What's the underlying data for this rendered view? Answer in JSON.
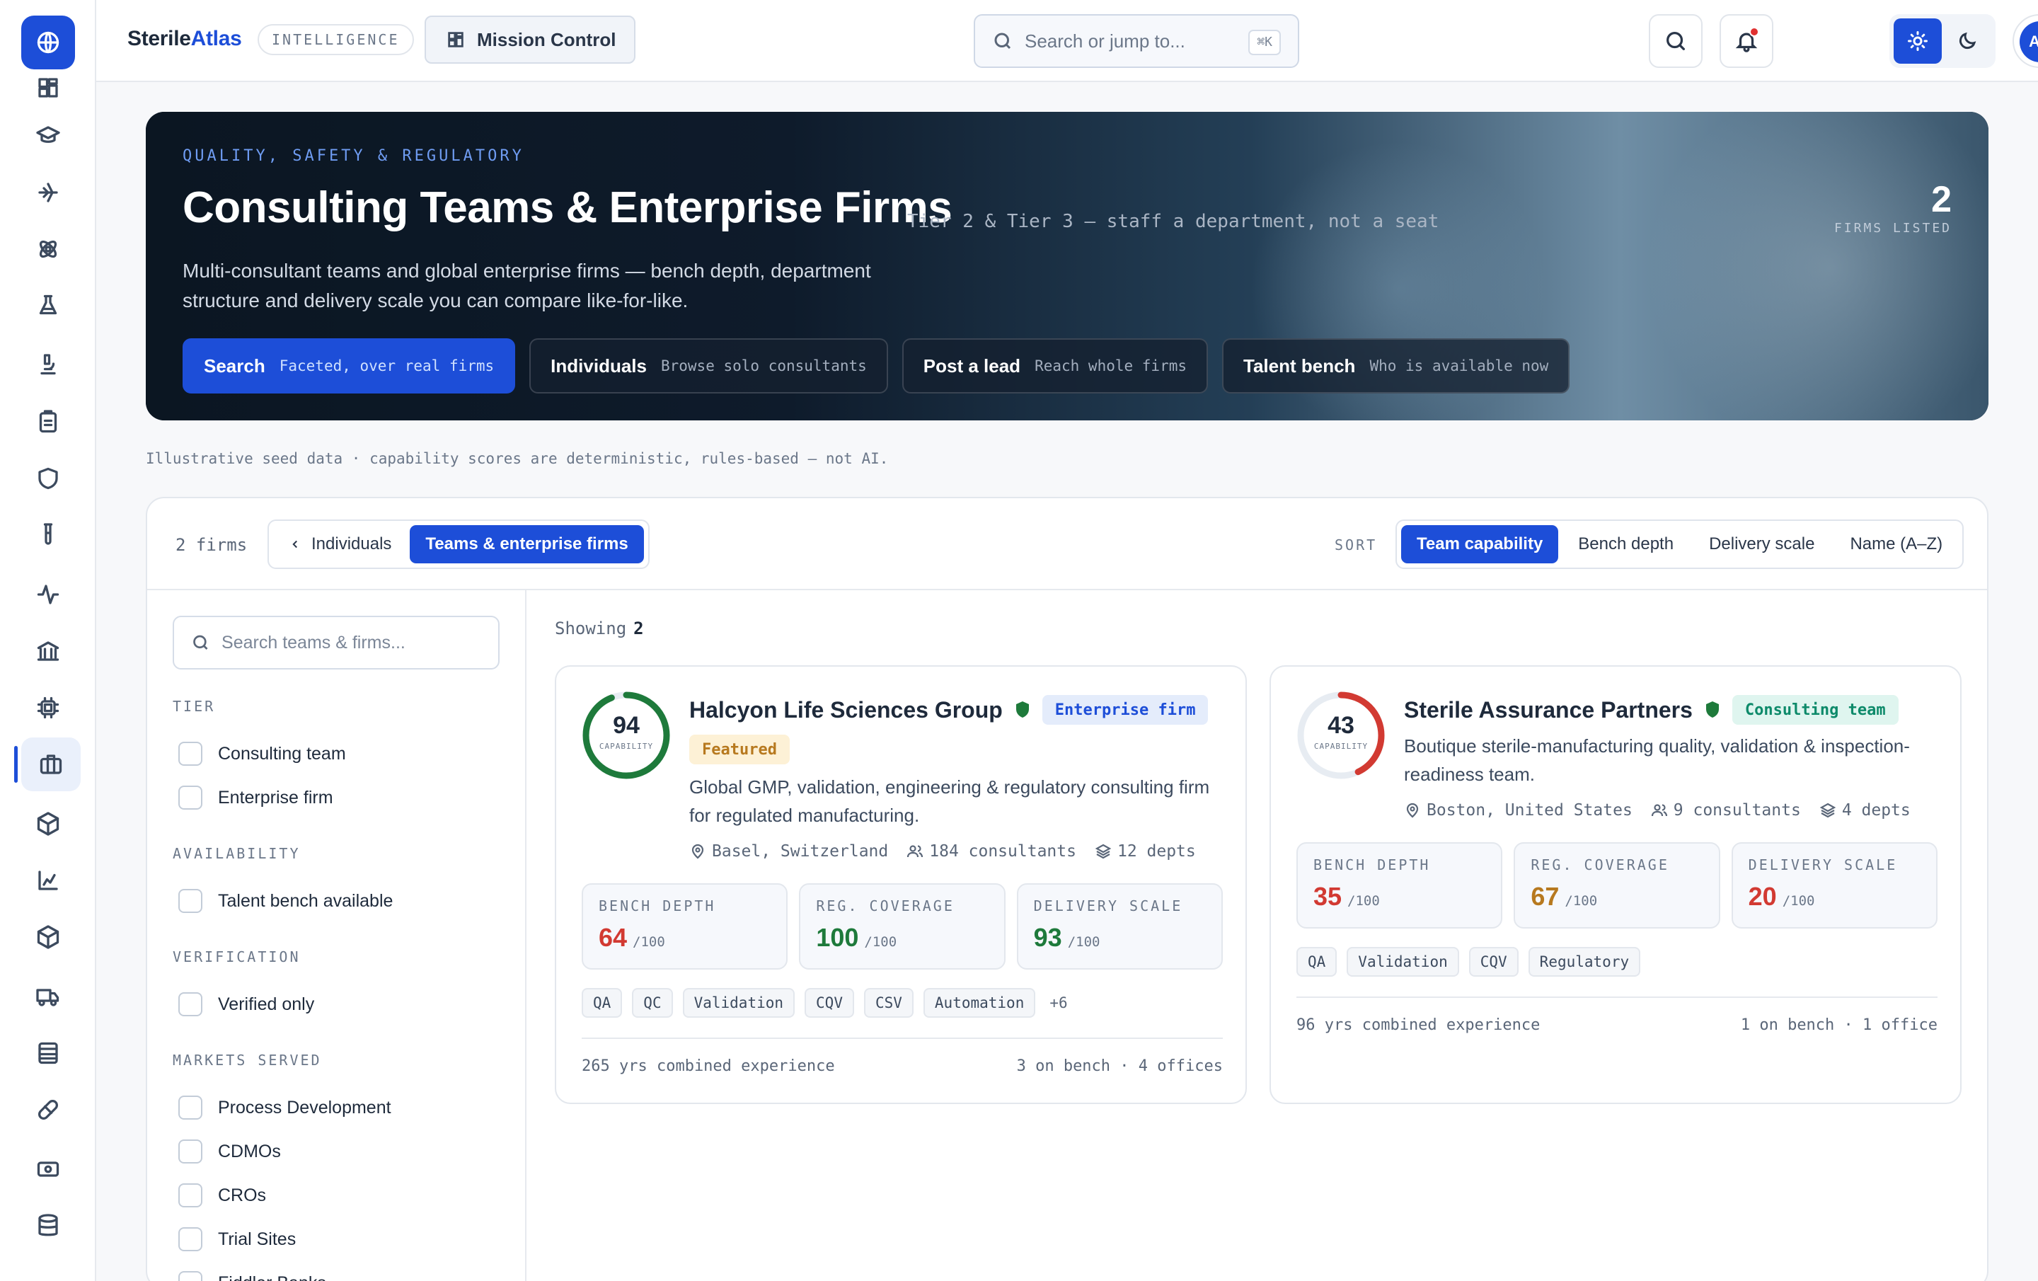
{
  "brand": {
    "name_a": "Sterile",
    "name_b": "Atlas",
    "chip": "INTELLIGENCE"
  },
  "topbar": {
    "mission_control": "Mission Control",
    "search_placeholder": "Search or jump to...",
    "shortcut": "⌘K",
    "avatar": "AR"
  },
  "rail": [
    "globe-icon",
    "dashboard-icon",
    "graduation-icon",
    "drone-icon",
    "atom-icon",
    "flask-icon",
    "microscope-icon",
    "clipboard-icon",
    "shield-icon",
    "test-tube-icon",
    "activity-icon",
    "bank-icon",
    "cpu-icon",
    "briefcase-icon",
    "package-icon",
    "chart-icon",
    "box-icon",
    "truck-icon",
    "server-icon",
    "pill-icon",
    "cash-icon",
    "database-icon"
  ],
  "hero": {
    "eyebrow": "QUALITY, SAFETY & REGULATORY",
    "title": "Consulting Teams & Enterprise Firms",
    "tagline": "Tier 2 & Tier 3 — staff a department, not a seat",
    "description": "Multi-consultant teams and global enterprise firms — bench depth, department structure and delivery scale you can compare like-for-like.",
    "count": "2",
    "count_label": "FIRMS LISTED",
    "actions": [
      {
        "title": "Search",
        "sub": "Faceted, over real firms"
      },
      {
        "title": "Individuals",
        "sub": "Browse solo consultants"
      },
      {
        "title": "Post a lead",
        "sub": "Reach whole firms"
      },
      {
        "title": "Talent bench",
        "sub": "Who is available now"
      }
    ]
  },
  "disclaimer": "Illustrative seed data · capability scores are deterministic, rules-based — not AI.",
  "toolbar": {
    "count": "2 firms",
    "seg_individuals": "Individuals",
    "seg_teams": "Teams & enterprise firms",
    "sort_label": "SORT",
    "sort_options": [
      "Team capability",
      "Bench depth",
      "Delivery scale",
      "Name (A–Z)"
    ]
  },
  "filters": {
    "search_placeholder": "Search teams & firms...",
    "tier": {
      "title": "TIER",
      "options": [
        "Consulting team",
        "Enterprise firm"
      ]
    },
    "availability": {
      "title": "AVAILABILITY",
      "options": [
        "Talent bench available"
      ]
    },
    "verification": {
      "title": "VERIFICATION",
      "options": [
        "Verified only"
      ]
    },
    "markets": {
      "title": "MARKETS SERVED",
      "options": [
        "Process Development",
        "CDMOs",
        "CROs",
        "Trial Sites",
        "Fiddler Banks"
      ]
    }
  },
  "results": {
    "label": "Showing",
    "count": "2"
  },
  "cards": [
    {
      "score": "94",
      "score_value": 94,
      "score_color": "#1e7a3b",
      "score_label": "CAPABILITY",
      "name": "Halcyon Life Sciences Group",
      "badge": "Enterprise firm",
      "featured": "Featured",
      "description": "Global GMP, validation, engineering & regulatory consulting firm for regulated manufacturing.",
      "location": "Basel, Switzerland",
      "consultants": "184 consultants",
      "depts": "12 depts",
      "metrics": [
        {
          "label": "BENCH DEPTH",
          "value": "64",
          "max": "/100"
        },
        {
          "label": "REG. COVERAGE",
          "value": "100",
          "max": "/100"
        },
        {
          "label": "DELIVERY SCALE",
          "value": "93",
          "max": "/100"
        }
      ],
      "tags": [
        "QA",
        "QC",
        "Validation",
        "CQV",
        "CSV",
        "Automation"
      ],
      "more": "+6",
      "experience": "265 yrs combined experience",
      "footer_right": "3 on bench · 4 offices"
    },
    {
      "score": "43",
      "score_value": 43,
      "score_color": "#d23a32",
      "score_label": "CAPABILITY",
      "name": "Sterile Assurance Partners",
      "badge": "Consulting team",
      "description": "Boutique sterile-manufacturing quality, validation & inspection-readiness team.",
      "location": "Boston, United States",
      "consultants": "9 consultants",
      "depts": "4 depts",
      "metrics": [
        {
          "label": "BENCH DEPTH",
          "value": "35",
          "max": "/100"
        },
        {
          "label": "REG. COVERAGE",
          "value": "67",
          "max": "/100"
        },
        {
          "label": "DELIVERY SCALE",
          "value": "20",
          "max": "/100"
        }
      ],
      "tags": [
        "QA",
        "Validation",
        "CQV",
        "Regulatory"
      ],
      "experience": "96 yrs combined experience",
      "footer_right": "1 on bench · 1 office"
    }
  ],
  "colors": {
    "accent": "#1d4ed8",
    "good": "#1e7a3b",
    "warn": "#b7791f",
    "bad": "#d23a32"
  }
}
